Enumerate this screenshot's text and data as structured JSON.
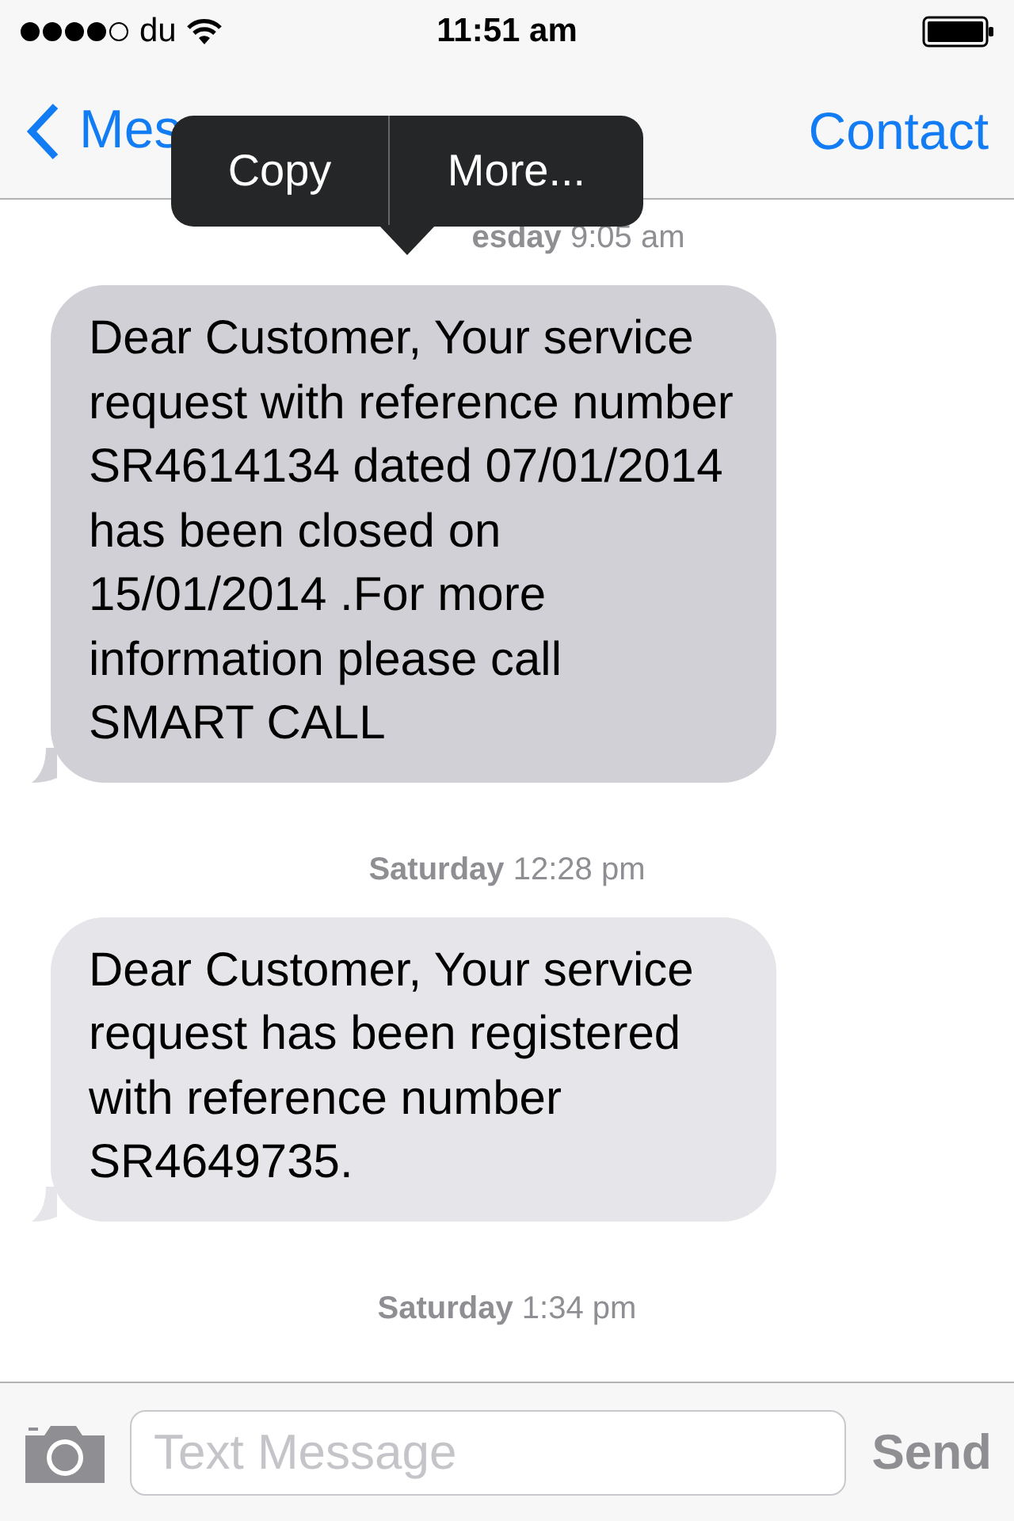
{
  "status_bar": {
    "carrier": "du",
    "time": "11:51 am"
  },
  "nav": {
    "back": "Mes",
    "action": "Contact"
  },
  "popup": {
    "items": [
      "Copy",
      "More..."
    ]
  },
  "thread": [
    {
      "kind": "timestamp",
      "day": "esday",
      "time": "9:05 am"
    },
    {
      "kind": "received",
      "text": "Dear Customer, Your service request with reference number SR4614134 dated 07/01/2014 has been closed on 15/01/2014 .For more information please call SMART CALL",
      "selected": true
    },
    {
      "kind": "timestamp",
      "day": "Saturday",
      "time": "12:28 pm"
    },
    {
      "kind": "received",
      "text": "Dear Customer, Your service request has been registered with reference number SR4649735.",
      "selected": false
    },
    {
      "kind": "timestamp",
      "day": "Saturday",
      "time": "1:34 pm"
    }
  ],
  "composer": {
    "placeholder": "Text Message",
    "send": "Send"
  }
}
